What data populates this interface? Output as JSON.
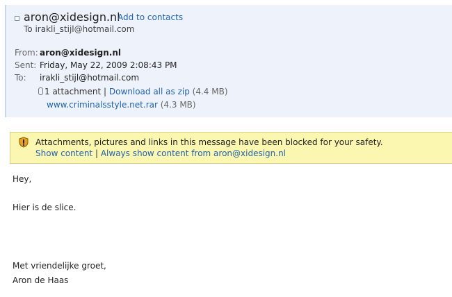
{
  "header": {
    "sender": "aron@xidesign.nl",
    "add_contacts": "Add to contacts",
    "to_summary": "To irakli_stijl@hotmail.com",
    "from_label": "From:",
    "from_value": "aron@xidesign.nl",
    "sent_label": "Sent:",
    "sent_value": "Friday, May 22, 2009 2:08:43 PM",
    "to_label": "To:",
    "to_value": "irakli_stijl@hotmail.com",
    "attachment_count": "1 attachment",
    "separator": "|",
    "download_all": "Download all as zip",
    "download_size": "(4.4 MB)",
    "file_name": "www.criminalsstyle.net.rar",
    "file_size": "(4.3 MB)"
  },
  "warning": {
    "message": "Attachments, pictures and links in this message have been blocked for your safety.",
    "show_content": "Show content",
    "separator": "|",
    "always_show": "Always show content from aron@xidesign.nl"
  },
  "body": {
    "greeting": "Hey,",
    "line1": "Hier is de slice.",
    "closing": "Met vriendelijke groet,",
    "signature": "Aron de Haas"
  },
  "colors": {
    "header_bg": "#eef3fb",
    "link": "#2162b0",
    "warning_bg": "#fcf7b0"
  }
}
